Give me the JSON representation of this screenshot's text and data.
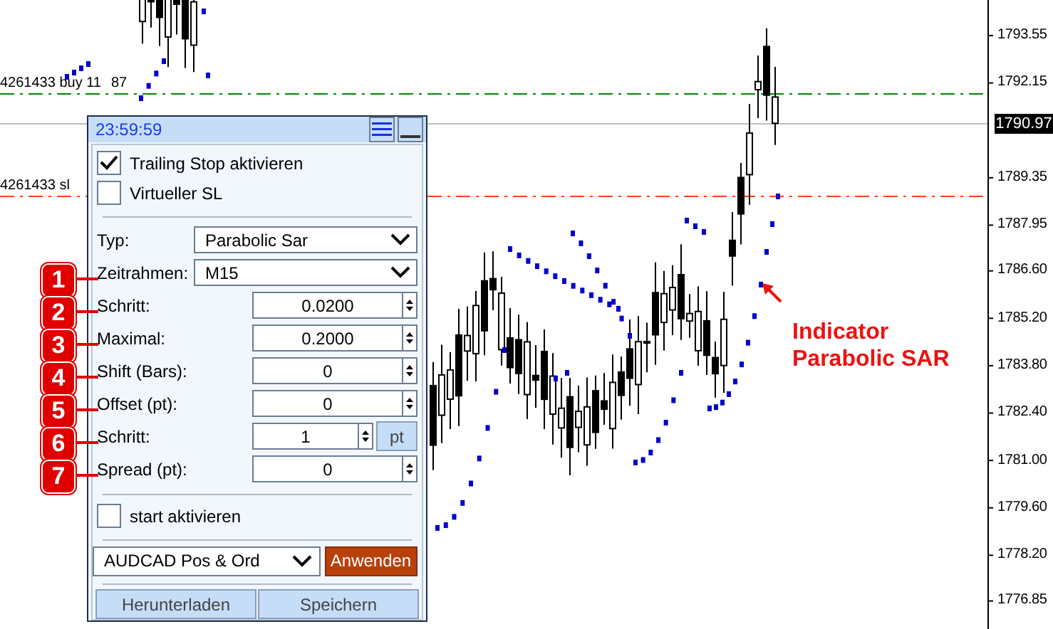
{
  "chart": {
    "price_axis": [
      "1793.55",
      "1792.15",
      "1789.35",
      "1787.95",
      "1786.60",
      "1785.20",
      "1783.80",
      "1782.40",
      "1781.00",
      "1779.60",
      "1778.20",
      "1776.85"
    ],
    "current_price": "1790.97",
    "order_lines": [
      {
        "kind": "buy",
        "text": "4261433 buy 11",
        "text_2": "87"
      },
      {
        "kind": "sl",
        "text": "4261433 sl"
      }
    ]
  },
  "panel": {
    "time": "23:59:59",
    "checks": [
      {
        "label": "Trailing Stop aktivieren",
        "checked": true
      },
      {
        "label": "Virtueller SL",
        "checked": false
      }
    ],
    "fields": [
      {
        "kind": "select",
        "label": "Typ:",
        "value": "Parabolic Sar"
      },
      {
        "kind": "select",
        "label": "Zeitrahmen:",
        "value": "M15",
        "marker": "1"
      },
      {
        "kind": "spin",
        "label": "Schritt:",
        "value": "0.0200",
        "marker": "2"
      },
      {
        "kind": "spin",
        "label": "Maximal:",
        "value": "0.2000",
        "marker": "3"
      },
      {
        "kind": "spin",
        "label": "Shift (Bars):",
        "value": "0",
        "marker": "4"
      },
      {
        "kind": "spin",
        "label": "Offset (pt):",
        "value": "0",
        "marker": "5"
      },
      {
        "kind": "spin_unit",
        "label": "Schritt:",
        "value": "1",
        "unit": "pt",
        "marker": "6"
      },
      {
        "kind": "spin",
        "label": "Spread (pt):",
        "value": "0",
        "marker": "7"
      }
    ],
    "start_check": {
      "label": "start aktivieren",
      "checked": false
    },
    "preset": "AUDCAD Pos & Ord",
    "apply": "Anwenden",
    "buttons": [
      "Herunterladen",
      "Speichern"
    ]
  },
  "annotation": {
    "lines": [
      "Indicator",
      "Parabolic SAR"
    ]
  }
}
